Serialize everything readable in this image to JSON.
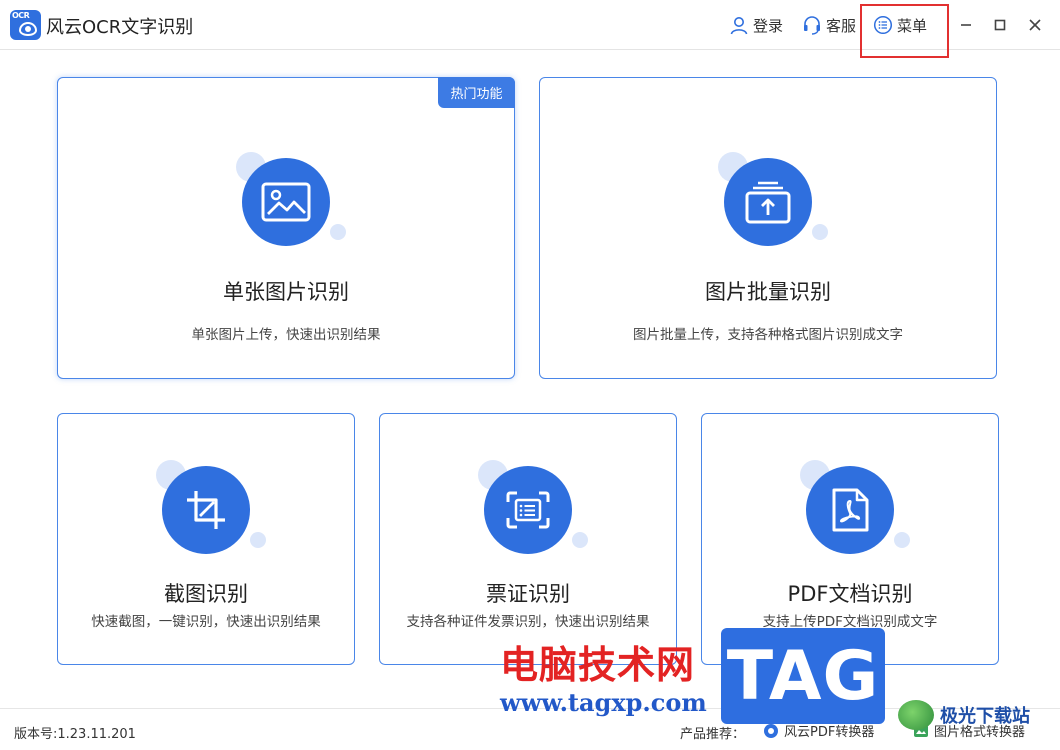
{
  "app": {
    "logo_text": "OCR",
    "title": "风云OCR文字识别"
  },
  "titlebar": {
    "login_label": "登录",
    "service_label": "客服",
    "menu_label": "菜单",
    "highlight_color": "#e23030"
  },
  "cards": {
    "single": {
      "badge": "热门功能",
      "title": "单张图片识别",
      "desc": "单张图片上传，快速出识别结果",
      "icon": "image-icon"
    },
    "batch": {
      "title": "图片批量识别",
      "desc": "图片批量上传，支持各种格式图片识别成文字",
      "icon": "upload-stack-icon"
    },
    "screenshot": {
      "title": "截图识别",
      "desc": "快速截图，一键识别，快速出识别结果",
      "icon": "crop-icon"
    },
    "invoice": {
      "title": "票证识别",
      "desc": "支持各种证件发票识别，快速出识别结果",
      "icon": "scan-document-icon"
    },
    "pdf": {
      "title": "PDF文档识别",
      "desc": "支持上传PDF文档识别成文字",
      "icon": "pdf-file-icon"
    }
  },
  "statusbar": {
    "version": "版本号:1.23.11.201",
    "recommend_label": "产品推荐：",
    "rec_pdf": "风云PDF转换器",
    "rec_img": "图片格式转换器"
  },
  "watermark": {
    "cn": "电脑技术网",
    "url": "www.tagxp.com",
    "tag": "TAG",
    "site": "极光下载站"
  },
  "colors": {
    "accent": "#2f6fde",
    "card_border": "#4a86e8",
    "deco": "#dbe6fa"
  }
}
